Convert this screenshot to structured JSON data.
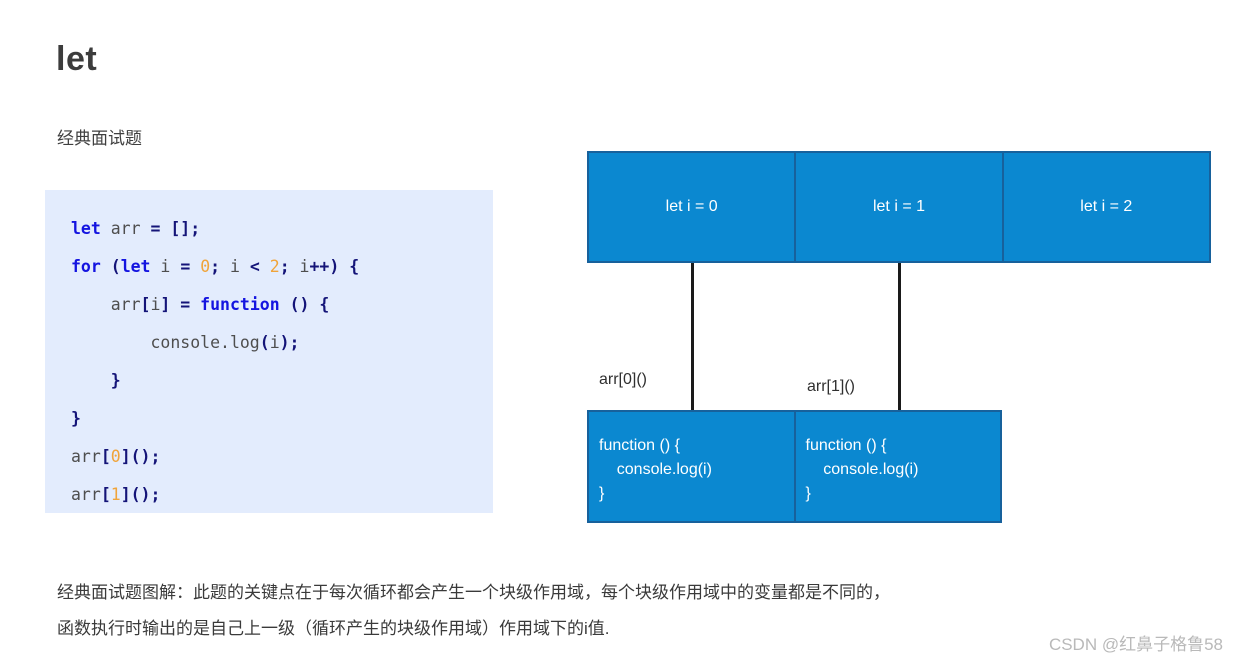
{
  "page": {
    "title": "let",
    "subtitle": "经典面试题"
  },
  "code": {
    "lines": [
      [
        {
          "text": "let",
          "cls": "k"
        },
        {
          "text": " arr ",
          "cls": "t"
        },
        {
          "text": "=",
          "cls": "p"
        },
        {
          "text": " ",
          "cls": "t"
        },
        {
          "text": "[];",
          "cls": "p"
        }
      ],
      [
        {
          "text": "for",
          "cls": "k"
        },
        {
          "text": " ",
          "cls": "t"
        },
        {
          "text": "(",
          "cls": "p"
        },
        {
          "text": "let",
          "cls": "k"
        },
        {
          "text": " i ",
          "cls": "t"
        },
        {
          "text": "=",
          "cls": "p"
        },
        {
          "text": " ",
          "cls": "t"
        },
        {
          "text": "0",
          "cls": "n"
        },
        {
          "text": ";",
          "cls": "p"
        },
        {
          "text": " i ",
          "cls": "t"
        },
        {
          "text": "<",
          "cls": "p"
        },
        {
          "text": " ",
          "cls": "t"
        },
        {
          "text": "2",
          "cls": "n"
        },
        {
          "text": ";",
          "cls": "p"
        },
        {
          "text": " i",
          "cls": "t"
        },
        {
          "text": "++)",
          "cls": "p"
        },
        {
          "text": " ",
          "cls": "t"
        },
        {
          "text": "{",
          "cls": "p"
        }
      ],
      [
        {
          "text": "    arr",
          "cls": "t"
        },
        {
          "text": "[",
          "cls": "p"
        },
        {
          "text": "i",
          "cls": "t"
        },
        {
          "text": "]",
          "cls": "p"
        },
        {
          "text": " ",
          "cls": "t"
        },
        {
          "text": "=",
          "cls": "p"
        },
        {
          "text": " ",
          "cls": "t"
        },
        {
          "text": "function",
          "cls": "k"
        },
        {
          "text": " ",
          "cls": "t"
        },
        {
          "text": "()",
          "cls": "p"
        },
        {
          "text": " ",
          "cls": "t"
        },
        {
          "text": "{",
          "cls": "p"
        }
      ],
      [
        {
          "text": "        console.log",
          "cls": "t"
        },
        {
          "text": "(",
          "cls": "p"
        },
        {
          "text": "i",
          "cls": "t"
        },
        {
          "text": ");",
          "cls": "p"
        }
      ],
      [
        {
          "text": "    ",
          "cls": "t"
        },
        {
          "text": "}",
          "cls": "p"
        }
      ],
      [
        {
          "text": "}",
          "cls": "p"
        }
      ],
      [
        {
          "text": "arr",
          "cls": "t"
        },
        {
          "text": "[",
          "cls": "p"
        },
        {
          "text": "0",
          "cls": "n"
        },
        {
          "text": "]();",
          "cls": "p"
        }
      ],
      [
        {
          "text": "arr",
          "cls": "t"
        },
        {
          "text": "[",
          "cls": "p"
        },
        {
          "text": "1",
          "cls": "n"
        },
        {
          "text": "]();",
          "cls": "p"
        }
      ]
    ]
  },
  "diagram": {
    "scopes": [
      {
        "label": "let i = 0"
      },
      {
        "label": "let i = 1"
      },
      {
        "label": "let i = 2"
      }
    ],
    "functions": [
      {
        "body": "function () {\n    console.log(i)\n}"
      },
      {
        "body": "function () {\n    console.log(i)\n}"
      }
    ],
    "call_labels": [
      {
        "label": "arr[0]()"
      },
      {
        "label": "arr[1]()"
      }
    ],
    "colors": {
      "box_fill": "#0b88d0",
      "box_border": "#17619c",
      "connector": "#1a1a1a",
      "box_text": "#ffffff"
    }
  },
  "caption": {
    "line1": "经典面试题图解：此题的关键点在于每次循环都会产生一个块级作用域，每个块级作用域中的变量都是不同的，",
    "line2": "函数执行时输出的是自己上一级（循环产生的块级作用域）作用域下的i值."
  },
  "watermark": {
    "text": "CSDN @红鼻子格鲁58"
  }
}
